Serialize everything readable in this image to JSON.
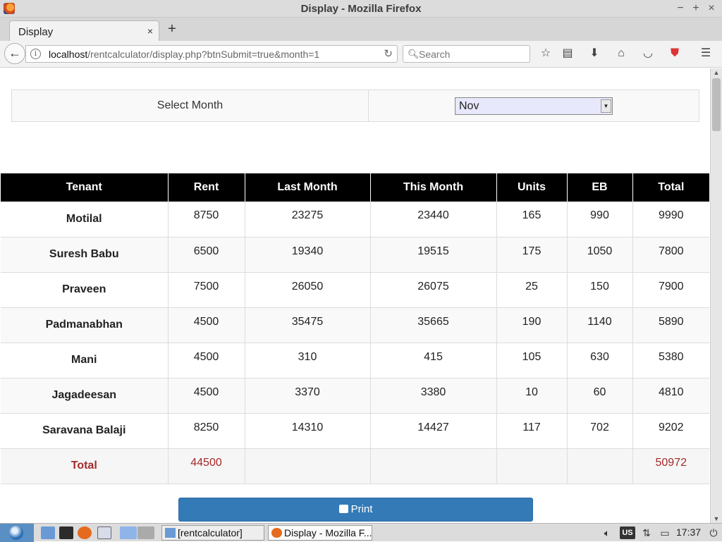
{
  "window": {
    "title": "Display - Mozilla Firefox",
    "controls": {
      "minimize": "−",
      "maximize": "+",
      "close": "×"
    }
  },
  "tab": {
    "label": "Display",
    "close": "×",
    "new_tab": "+"
  },
  "nav": {
    "url_host": "localhost",
    "url_path": "/rentcalculator/display.php?btnSubmit=true&month=1",
    "search_placeholder": "Search"
  },
  "month_selector": {
    "label": "Select Month",
    "selected": "Nov"
  },
  "table": {
    "headers": [
      "Tenant",
      "Rent",
      "Last Month",
      "This Month",
      "Units",
      "EB",
      "Total"
    ],
    "rows": [
      {
        "tenant": "Motilal",
        "rent": "8750",
        "last": "23275",
        "this": "23440",
        "units": "165",
        "eb": "990",
        "total": "9990"
      },
      {
        "tenant": "Suresh Babu",
        "rent": "6500",
        "last": "19340",
        "this": "19515",
        "units": "175",
        "eb": "1050",
        "total": "7800"
      },
      {
        "tenant": "Praveen",
        "rent": "7500",
        "last": "26050",
        "this": "26075",
        "units": "25",
        "eb": "150",
        "total": "7900"
      },
      {
        "tenant": "Padmanabhan",
        "rent": "4500",
        "last": "35475",
        "this": "35665",
        "units": "190",
        "eb": "1140",
        "total": "5890"
      },
      {
        "tenant": "Mani",
        "rent": "4500",
        "last": "310",
        "this": "415",
        "units": "105",
        "eb": "630",
        "total": "5380"
      },
      {
        "tenant": "Jagadeesan",
        "rent": "4500",
        "last": "3370",
        "this": "3380",
        "units": "10",
        "eb": "60",
        "total": "4810"
      },
      {
        "tenant": "Saravana Balaji",
        "rent": "8250",
        "last": "14310",
        "this": "14427",
        "units": "117",
        "eb": "702",
        "total": "9202"
      }
    ],
    "total": {
      "label": "Total",
      "rent": "44500",
      "grand": "50972"
    }
  },
  "print_label": "Print",
  "taskbar": {
    "tasks": [
      "[rentcalculator]",
      "Display - Mozilla F..."
    ],
    "keyboard": "US",
    "clock": "17:37"
  },
  "colors": {
    "accent": "#337ab7",
    "total_text": "#a52a2a",
    "header_bg": "#000000"
  }
}
